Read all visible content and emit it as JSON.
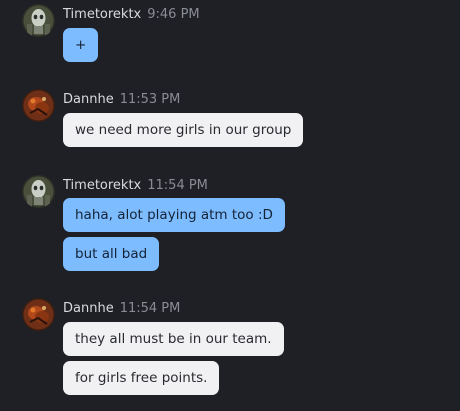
{
  "colors": {
    "background": "#1f2025",
    "bubble_self": "#7cbcff",
    "bubble_other": "#f1f1f3",
    "author_text": "#d8d9de",
    "time_text": "#8a8c94"
  },
  "messages": [
    {
      "author": "Timetorektx",
      "time": "9:46 PM",
      "avatar_icon": "skull-avatar-icon",
      "bubbles": [
        "+"
      ]
    },
    {
      "author": "Dannhe",
      "time": "11:53 PM",
      "avatar_icon": "red-creature-avatar-icon",
      "bubbles": [
        "we need more girls in our group"
      ]
    },
    {
      "author": "Timetorektx",
      "time": "11:54 PM",
      "avatar_icon": "skull-avatar-icon",
      "bubbles": [
        "haha, alot playing atm too :D",
        "but all bad"
      ]
    },
    {
      "author": "Dannhe",
      "time": "11:54 PM",
      "avatar_icon": "red-creature-avatar-icon",
      "bubbles": [
        "they all must be in our team.",
        "for girls free points."
      ]
    }
  ]
}
